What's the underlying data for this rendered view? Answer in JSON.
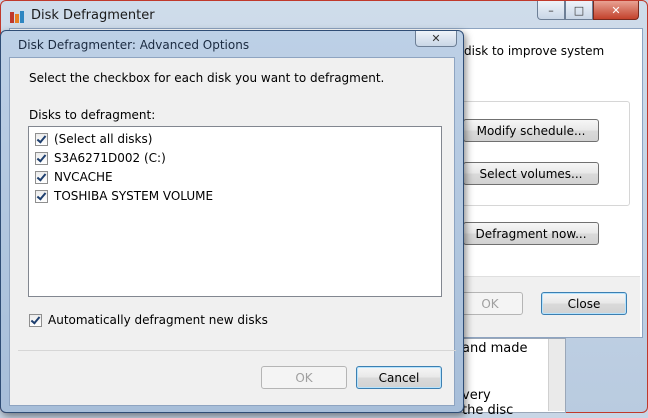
{
  "main_window": {
    "title": "Disk Defragmenter",
    "caption_minimize": "–",
    "caption_maximize": "□",
    "caption_close": "✕",
    "partial_text": "disk to improve system",
    "modify_schedule_label": "Modify schedule...",
    "select_volumes_label": "Select volumes...",
    "defragment_now_label": "Defragment now...",
    "ok_label": "OK",
    "close_label": "Close"
  },
  "background_window": {
    "text_line1": "and made",
    "text_line2": "very",
    "text_line3": "the disc"
  },
  "dialog": {
    "title": "Disk Defragmenter: Advanced Options",
    "close_glyph": "✕",
    "instruction": "Select the checkbox for each disk you want to defragment.",
    "disks_label": "Disks to defragment:",
    "disks": [
      {
        "label": "(Select all disks)",
        "checked": true
      },
      {
        "label": "S3A6271D002 (C:)",
        "checked": true
      },
      {
        "label": "NVCACHE",
        "checked": true
      },
      {
        "label": "TOSHIBA SYSTEM VOLUME",
        "checked": true
      }
    ],
    "auto_defrag_label": "Automatically defragment new disks",
    "auto_defrag_checked": true,
    "ok_label": "OK",
    "cancel_label": "Cancel"
  }
}
